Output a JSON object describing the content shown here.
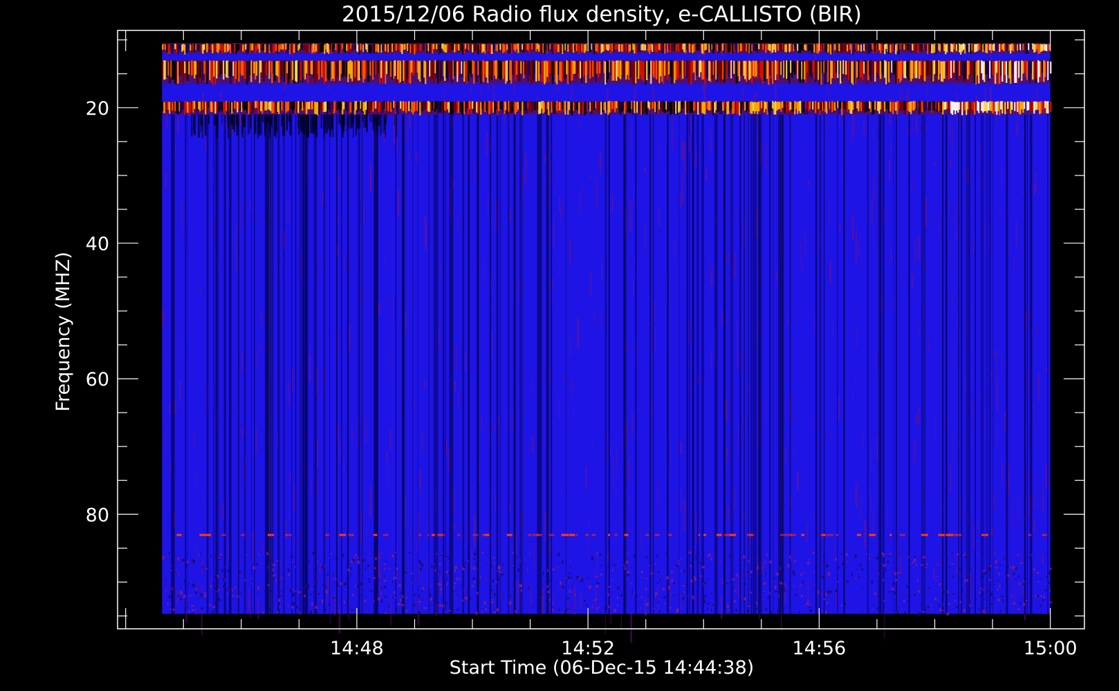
{
  "chart_data": {
    "type": "heatmap",
    "title": "2015/12/06  Radio flux density, e-CALLISTO (BIR)",
    "xlabel": "Start Time (06-Dec-15 14:44:38)",
    "ylabel": "Frequency (MHZ)",
    "x_tick_labels": [
      "14:48",
      "14:52",
      "14:56",
      "15:00"
    ],
    "x_tick_minutes": [
      3.37,
      7.37,
      11.37,
      15.37
    ],
    "y_tick_labels": [
      "20",
      "40",
      "60",
      "80"
    ],
    "y_ticks": [
      20,
      40,
      60,
      80
    ],
    "x_range_minutes": [
      0,
      15.37
    ],
    "xlim_minutes": [
      -0.77,
      15.96
    ],
    "y_range_mhz": [
      10.5,
      94.7
    ],
    "ylim_mhz": [
      8.6,
      96.9
    ],
    "y_inverted": true,
    "colormap": "black-blue-red-yellow-white",
    "background_level": "blue",
    "bright_bands_mhz": [
      [
        10.5,
        12
      ],
      [
        13,
        16.5
      ],
      [
        19,
        21
      ]
    ],
    "faint_line_mhz": 83,
    "active_window_minutes": [
      13.5,
      15.37
    ]
  },
  "colors": {
    "background": "#000000",
    "axis": "#ffffff",
    "base_blue": "#1e14e6"
  }
}
